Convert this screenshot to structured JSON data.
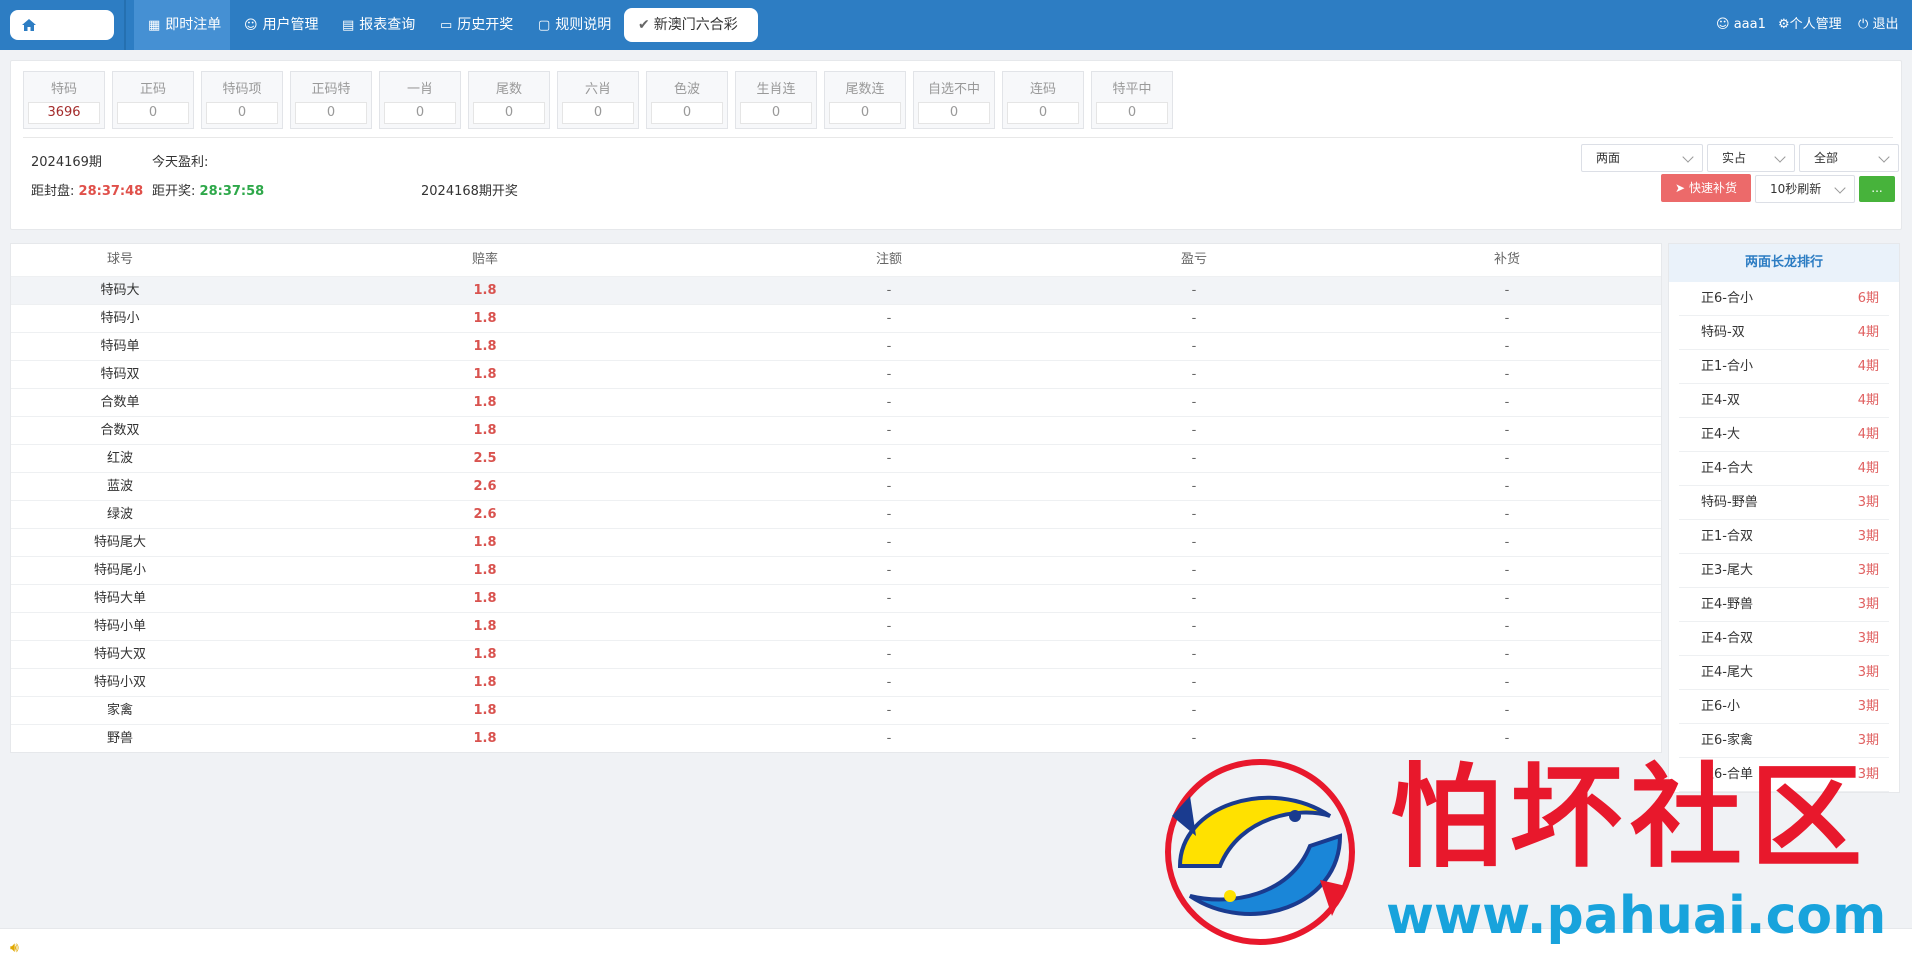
{
  "nav": {
    "items": [
      {
        "label": "即时注单",
        "icon": "grid-icon"
      },
      {
        "label": "用户管理",
        "icon": "user-icon"
      },
      {
        "label": "报表查询",
        "icon": "report-icon"
      },
      {
        "label": "历史开奖",
        "icon": "monitor-icon"
      },
      {
        "label": "规则说明",
        "icon": "chat-icon"
      }
    ],
    "game_tab": "新澳门六合彩",
    "user": "aaa1",
    "profile": "个人管理",
    "logout": "退出"
  },
  "categories": [
    {
      "label": "特码",
      "value": "3696"
    },
    {
      "label": "正码",
      "value": "0"
    },
    {
      "label": "特码项",
      "value": "0"
    },
    {
      "label": "正码特",
      "value": "0"
    },
    {
      "label": "一肖",
      "value": "0"
    },
    {
      "label": "尾数",
      "value": "0"
    },
    {
      "label": "六肖",
      "value": "0"
    },
    {
      "label": "色波",
      "value": "0"
    },
    {
      "label": "生肖连",
      "value": "0"
    },
    {
      "label": "尾数连",
      "value": "0"
    },
    {
      "label": "自选不中",
      "value": "0"
    },
    {
      "label": "连码",
      "value": "0"
    },
    {
      "label": "特平中",
      "value": "0"
    }
  ],
  "info": {
    "period": "2024169期",
    "profit_label": "今天盈利:",
    "close_label": "距封盘:",
    "close_time": "28:37:48",
    "draw_label": "距开奖:",
    "draw_time": "28:37:58",
    "last_draw": "2024168期开奖"
  },
  "controls": {
    "type_select": "两面",
    "mode_select": "实占",
    "scope_select": "全部",
    "quick_button": "快速补货",
    "refresh_select": "10秒刷新",
    "more_button": "..."
  },
  "table": {
    "headers": [
      "球号",
      "赔率",
      "注额",
      "盈亏",
      "补货"
    ],
    "rows": [
      {
        "name": "特码大",
        "odds": "1.8",
        "bet": "-",
        "pl": "-",
        "refill": "-"
      },
      {
        "name": "特码小",
        "odds": "1.8",
        "bet": "-",
        "pl": "-",
        "refill": "-"
      },
      {
        "name": "特码单",
        "odds": "1.8",
        "bet": "-",
        "pl": "-",
        "refill": "-"
      },
      {
        "name": "特码双",
        "odds": "1.8",
        "bet": "-",
        "pl": "-",
        "refill": "-"
      },
      {
        "name": "合数单",
        "odds": "1.8",
        "bet": "-",
        "pl": "-",
        "refill": "-"
      },
      {
        "name": "合数双",
        "odds": "1.8",
        "bet": "-",
        "pl": "-",
        "refill": "-"
      },
      {
        "name": "红波",
        "odds": "2.5",
        "bet": "-",
        "pl": "-",
        "refill": "-"
      },
      {
        "name": "蓝波",
        "odds": "2.6",
        "bet": "-",
        "pl": "-",
        "refill": "-"
      },
      {
        "name": "绿波",
        "odds": "2.6",
        "bet": "-",
        "pl": "-",
        "refill": "-"
      },
      {
        "name": "特码尾大",
        "odds": "1.8",
        "bet": "-",
        "pl": "-",
        "refill": "-"
      },
      {
        "name": "特码尾小",
        "odds": "1.8",
        "bet": "-",
        "pl": "-",
        "refill": "-"
      },
      {
        "name": "特码大单",
        "odds": "1.8",
        "bet": "-",
        "pl": "-",
        "refill": "-"
      },
      {
        "name": "特码小单",
        "odds": "1.8",
        "bet": "-",
        "pl": "-",
        "refill": "-"
      },
      {
        "name": "特码大双",
        "odds": "1.8",
        "bet": "-",
        "pl": "-",
        "refill": "-"
      },
      {
        "name": "特码小双",
        "odds": "1.8",
        "bet": "-",
        "pl": "-",
        "refill": "-"
      },
      {
        "name": "家禽",
        "odds": "1.8",
        "bet": "-",
        "pl": "-",
        "refill": "-"
      },
      {
        "name": "野兽",
        "odds": "1.8",
        "bet": "-",
        "pl": "-",
        "refill": "-"
      }
    ]
  },
  "ranking": {
    "title": "两面长龙排行",
    "items": [
      {
        "name": "正6-合小",
        "count": "6期"
      },
      {
        "name": "特码-双",
        "count": "4期"
      },
      {
        "name": "正1-合小",
        "count": "4期"
      },
      {
        "name": "正4-双",
        "count": "4期"
      },
      {
        "name": "正4-大",
        "count": "4期"
      },
      {
        "name": "正4-合大",
        "count": "4期"
      },
      {
        "name": "特码-野兽",
        "count": "3期"
      },
      {
        "name": "正1-合双",
        "count": "3期"
      },
      {
        "name": "正3-尾大",
        "count": "3期"
      },
      {
        "name": "正4-野兽",
        "count": "3期"
      },
      {
        "name": "正4-合双",
        "count": "3期"
      },
      {
        "name": "正4-尾大",
        "count": "3期"
      },
      {
        "name": "正6-小",
        "count": "3期"
      },
      {
        "name": "正6-家禽",
        "count": "3期"
      },
      {
        "name": "正6-合单",
        "count": "3期"
      }
    ]
  },
  "watermark": {
    "brand": "怕坏社区",
    "url": "www.pahuai.com"
  },
  "colors": {
    "nav": "#2d7dc3",
    "odds": "#d9534f",
    "close_time": "#e0504a",
    "draw_time": "#2ea84a",
    "quick_button": "#ec6a6a",
    "more_button": "#47b33b"
  }
}
